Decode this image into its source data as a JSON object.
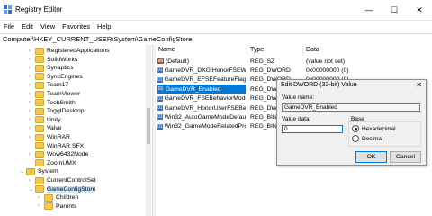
{
  "window": {
    "title": "Registry Editor",
    "minimize": "—",
    "maximize": "☐",
    "close": "✕"
  },
  "menu": [
    "File",
    "Edit",
    "View",
    "Favorites",
    "Help"
  ],
  "address": "Computer\\HKEY_CURRENT_USER\\System\\GameConfigStore",
  "tree": [
    {
      "label": "RegisteredApplications",
      "indent": 1,
      "expander": ">"
    },
    {
      "label": "SolidWorks",
      "indent": 1,
      "expander": ">"
    },
    {
      "label": "Synaptics",
      "indent": 1,
      "expander": ">"
    },
    {
      "label": "SyncEngines",
      "indent": 1,
      "expander": ">"
    },
    {
      "label": "Team17",
      "indent": 1,
      "expander": ">"
    },
    {
      "label": "TeamViewer",
      "indent": 1,
      "expander": ">"
    },
    {
      "label": "TechSmith",
      "indent": 1,
      "expander": ">"
    },
    {
      "label": "ToggIDesktop",
      "indent": 1,
      "expander": ">"
    },
    {
      "label": "Unity",
      "indent": 1,
      "expander": ">"
    },
    {
      "label": "Valve",
      "indent": 1,
      "expander": ">"
    },
    {
      "label": "WinRAR",
      "indent": 1,
      "expander": ">"
    },
    {
      "label": "WinRAR SFX",
      "indent": 1,
      "expander": ""
    },
    {
      "label": "Wow6432Node",
      "indent": 1,
      "expander": ">"
    },
    {
      "label": "ZoomUMX",
      "indent": 1,
      "expander": ""
    },
    {
      "label": "System",
      "indent": 0,
      "expander": "v"
    },
    {
      "label": "CurrentControlSet",
      "indent": 1,
      "expander": ">"
    },
    {
      "label": "GameConfigStore",
      "indent": 1,
      "expander": "v",
      "selected": true
    },
    {
      "label": "Children",
      "indent": 2,
      "expander": ">"
    },
    {
      "label": "Parents",
      "indent": 2,
      "expander": ">"
    }
  ],
  "columns": {
    "name": "Name",
    "type": "Type",
    "data": "Data"
  },
  "rows": [
    {
      "name": "(Default)",
      "type": "REG_SZ",
      "data": "(value not set)",
      "kind": "sz"
    },
    {
      "name": "GameDVR_DXGIHonorFSEWin...",
      "type": "REG_DWORD",
      "data": "0x00000000 (0)",
      "kind": "dw"
    },
    {
      "name": "GameDVR_EFSEFeatureFlags",
      "type": "REG_DWORD",
      "data": "0x00000000 (0)",
      "kind": "dw"
    },
    {
      "name": "GameDVR_Enabled",
      "type": "REG_DWORD",
      "data": "0x00000001 (1)",
      "kind": "dw",
      "selected": true
    },
    {
      "name": "GameDVR_FSEBehaviorMode",
      "type": "REG_DWORD",
      "data": "",
      "kind": "dw"
    },
    {
      "name": "GameDVR_HonorUserFSEBeha...",
      "type": "REG_DWORD",
      "data": "",
      "kind": "dw"
    },
    {
      "name": "Win32_AutoGameModeDefaul...",
      "type": "REG_BINAR",
      "data": "",
      "kind": "dw"
    },
    {
      "name": "Win32_GameModeRelatedPro...",
      "type": "REG_BINAR",
      "data": "",
      "kind": "dw"
    }
  ],
  "dialog": {
    "title": "Edit DWORD (32-bit) Value",
    "close": "✕",
    "value_name_label": "Value name:",
    "value_name": "GameDVR_Enabled",
    "value_data_label": "Value data:",
    "value_data": "0",
    "base_label": "Base",
    "hex": "Hexadecimal",
    "dec": "Decimal",
    "base_selected": "hex",
    "ok": "OK",
    "cancel": "Cancel"
  }
}
